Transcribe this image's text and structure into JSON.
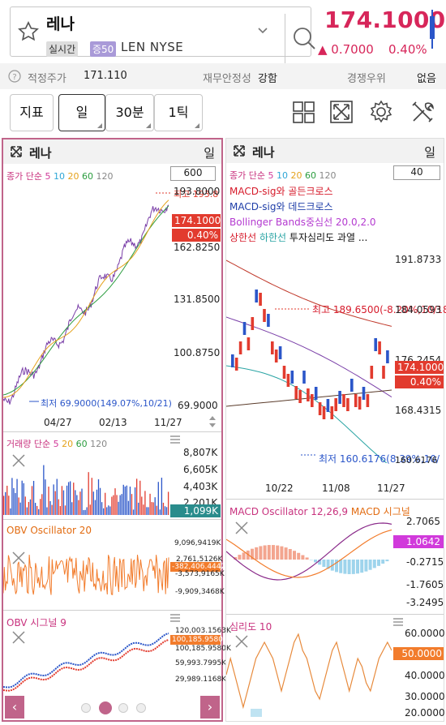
{
  "header": {
    "stock_name": "레나",
    "tag_realtime": "실시간",
    "tag_margin": "증50",
    "ticker": "LEN  NYSE",
    "price": "174.1000",
    "change": "▲ 0.7000",
    "change_pct": "0.40%"
  },
  "info": {
    "fair_price_label": "적정주가",
    "fair_price_value": "171.110",
    "stability_label": "재무안정성",
    "stability_value": "강함",
    "competition_label": "경쟁우위",
    "competition_value": "없음"
  },
  "toolbar": {
    "indicator": "지표",
    "day": "일",
    "min30": "30분",
    "tick": "1틱"
  },
  "left_chart": {
    "title": "레나",
    "period": "일",
    "legend_prefix": "종가 단순",
    "ma": [
      "5",
      "10",
      "20",
      "60",
      "120"
    ],
    "count": "600",
    "y_axis": [
      "193.8000",
      "162.8250",
      "131.8500",
      "100.8750",
      "69.9000"
    ],
    "price_badge": "174.1000",
    "pct_badge": "0.40%",
    "top_marker": "최고 193.8",
    "low_note": "최저 69.9000(149.07%,10/21)",
    "x_axis": [
      "04/27",
      "02/13",
      "11/27"
    ]
  },
  "volume": {
    "legend_prefix": "거래량 단순",
    "ma": [
      "5",
      "20",
      "60",
      "120"
    ],
    "y_axis": [
      "8,807K",
      "6,605K",
      "4,403K",
      "2,201K"
    ],
    "badge": "1,099K"
  },
  "obv20": {
    "legend": "OBV Oscillator 20",
    "y_axis": [
      "9,096,9419K",
      "2,761,5126K",
      "-3,573,9165K",
      "-9,909,3468K"
    ],
    "badge": "-382,406.4442"
  },
  "obv9": {
    "legend": "OBV 시그널 9",
    "y_axis": [
      "120,003.1563K",
      "100,185.9580K",
      "59,993.7995K",
      "29,989.1168K"
    ],
    "badge": "100,185.9580K"
  },
  "right_chart": {
    "title": "레나",
    "period": "일",
    "legend_prefix": "종가 단순",
    "ma": [
      "5",
      "10",
      "20",
      "60",
      "120"
    ],
    "count": "40",
    "signal1": "MACD-sig와 골든크로스",
    "signal2": "MACD-sig와 데드크로스",
    "signal3": "Bollinger Bands중심선 20.0,2.0",
    "signal4_a": "상한선",
    "signal4_b": "하한선",
    "signal4_c": "투자심리도 과열 ...",
    "y_axis": [
      "191.8733",
      "184.0593",
      "176.2454",
      "168.4315",
      "160.6176"
    ],
    "high_note": "최고 189.6500(-8.20%,10/18)",
    "low_note": "최저 160.6176(8.39%,10/",
    "price_badge": "174.1000",
    "pct_badge": "0.40%",
    "x_axis": [
      "10/22",
      "11/08",
      "11/27"
    ]
  },
  "macd": {
    "legend_a": "MACD Oscillator 12,26,9",
    "legend_b": "MACD 시그널",
    "y_axis": [
      "2.7065",
      "-0.2715",
      "-1.7605",
      "-3.2495"
    ],
    "badge": "1.0642"
  },
  "psych": {
    "legend": "심리도 10",
    "y_axis": [
      "60.0000",
      "40.0000",
      "30.0000",
      "20.0000"
    ],
    "badge": "50.0000"
  },
  "colors": {
    "accent": "#d7265a",
    "up": "#e23b2e",
    "down": "#2b56c9",
    "panel_border": "#c0648a"
  }
}
